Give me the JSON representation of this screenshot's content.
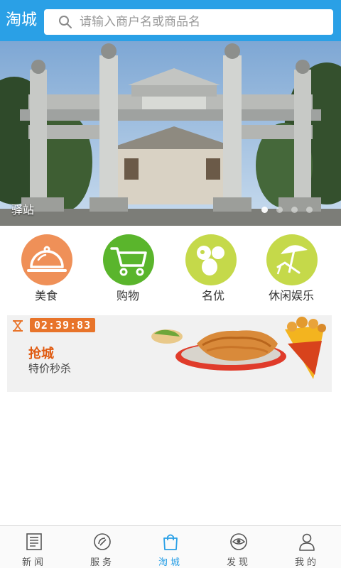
{
  "header": {
    "title": "淘城",
    "search": {
      "placeholder": "请输入商户名或商品名",
      "icon": "search-icon"
    }
  },
  "banner": {
    "caption": "驿站",
    "slide_count": 4,
    "active_slide": 1
  },
  "categories": [
    {
      "label": "美食",
      "icon": "food-cloche-icon",
      "color": "#ef9058"
    },
    {
      "label": "购物",
      "icon": "shopping-cart-icon",
      "color": "#5ab52c"
    },
    {
      "label": "名优",
      "icon": "specialty-product-icon",
      "color": "#c5d94a"
    },
    {
      "label": "休闲娱乐",
      "icon": "beach-umbrella-icon",
      "color": "#c5d94a"
    }
  ],
  "flash_sale": {
    "timer": "02:39:83",
    "title": "抢城",
    "subtitle": "特价秒杀",
    "accent": "#e8742a"
  },
  "tabbar": {
    "items": [
      {
        "label": "新闻",
        "icon": "newspaper-icon",
        "active": false
      },
      {
        "label": "服务",
        "icon": "service-icon",
        "active": false
      },
      {
        "label": "淘城",
        "icon": "shopping-bag-icon",
        "active": true
      },
      {
        "label": "发现",
        "icon": "eye-icon",
        "active": false
      },
      {
        "label": "我的",
        "icon": "user-icon",
        "active": false
      }
    ],
    "active_color": "#2aa0e6"
  }
}
